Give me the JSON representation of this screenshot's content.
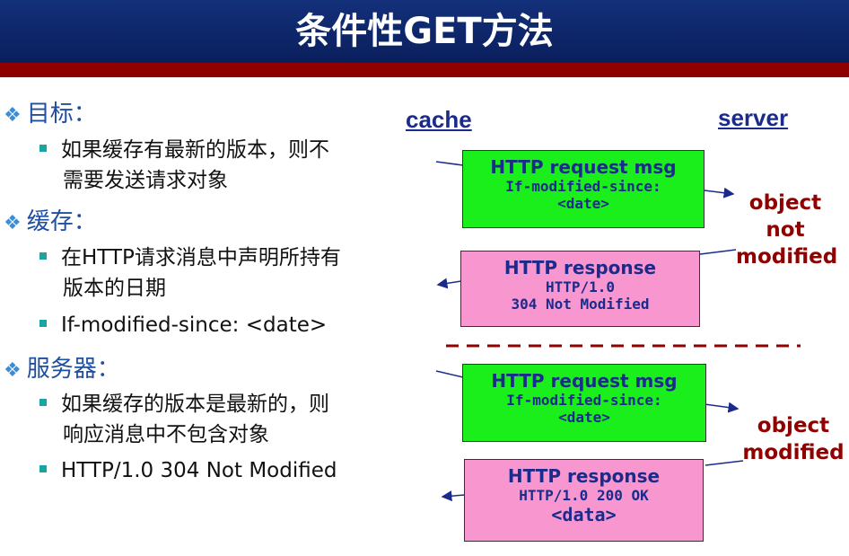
{
  "title": "条件性GET方法",
  "left": {
    "sections": [
      {
        "heading": "目标：",
        "items": [
          [
            "如果缓存有最新的版本，则不",
            "需要发送请求对象"
          ]
        ]
      },
      {
        "heading": "缓存：",
        "items": [
          [
            "在HTTP请求消息中声明所持有",
            "版本的日期"
          ],
          [
            "If-modified-since: <date>"
          ]
        ]
      },
      {
        "heading": "服务器：",
        "items": [
          [
            "如果缓存的版本是最新的，则",
            "响应消息中不包含对象"
          ],
          [
            "HTTP/1.0 304 Not Modified"
          ]
        ]
      }
    ]
  },
  "diagram": {
    "cache_label": "cache",
    "server_label": "server",
    "box1": {
      "head": "HTTP request msg",
      "line1": "If-modified-since:",
      "line2": "<date>"
    },
    "box2": {
      "head": "HTTP response",
      "line1": "HTTP/1.0",
      "line2": "304 Not Modified"
    },
    "box3": {
      "head": "HTTP request msg",
      "line1": "If-modified-since:",
      "line2": "<date>"
    },
    "box4": {
      "head": "HTTP response",
      "line1": "HTTP/1.0 200 OK",
      "line2": "<data>"
    },
    "note1": {
      "l1": "object",
      "l2": "not",
      "l3": "modified"
    },
    "note2": {
      "l1": "object",
      "l2": "modified"
    }
  },
  "colors": {
    "title_bg": "#0a1f5c",
    "accent_red": "#8f0000",
    "request_box": "#1bef1b",
    "response_box": "#f896cf",
    "label_blue": "#1a2b8c"
  }
}
